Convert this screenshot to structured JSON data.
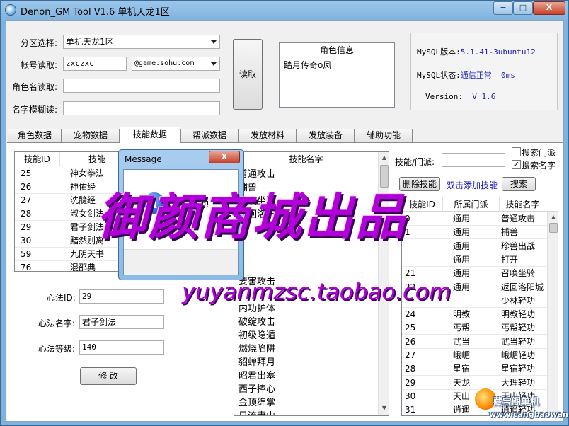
{
  "window": {
    "title": "Denon_GM Tool V1.6 单机天龙1区",
    "min_label": "−",
    "max_label": "□",
    "close_label": "X"
  },
  "top": {
    "zone_label": "分区选择:",
    "zone_value": "单机天龙1区",
    "account_label": "帐号读取:",
    "account_value": "zxczxc",
    "domain_value": "@game.sohu.com",
    "role_name_label": "角色名读取:",
    "fuzzy_label": "名字模糊读:",
    "read_button": "读取",
    "role_info_header": "角色信息",
    "role_info_items": [
      "踏月传奇o凤"
    ],
    "mysql_version_label": "MySQL版本:",
    "mysql_version_value": "5.1.41-3ubuntu12",
    "mysql_status_label": "MySQL状态:",
    "mysql_status_value": "通信正常",
    "mysql_status_ms": "0ms",
    "version_label": "Version:",
    "version_value": "V 1.6"
  },
  "tabs": [
    "角色数据",
    "宠物数据",
    "技能数据",
    "帮派数据",
    "发放材料",
    "发放装备",
    "辅助功能"
  ],
  "left_grid": {
    "headers": [
      "技能ID",
      "技能"
    ],
    "rows": [
      [
        "25",
        "神女拳法"
      ],
      [
        "26",
        "神佑经"
      ],
      [
        "27",
        "洗髓经"
      ],
      [
        "28",
        "淑女剑法"
      ],
      [
        "29",
        "君子剑法"
      ],
      [
        "30",
        "黯然别离"
      ],
      [
        "59",
        "九阴天书"
      ],
      [
        "76",
        "混邵典"
      ]
    ]
  },
  "xinfa": {
    "id_label": "心法ID:",
    "id_value": "29",
    "name_label": "心法名字:",
    "name_value": "君子剑法",
    "level_label": "心法等级:",
    "level_value": "140",
    "modify_button": "修  改"
  },
  "middle_list": {
    "header": "技能名字",
    "items": [
      "普通攻击",
      "捕兽",
      "召唤坐骑",
      "返回洛阳城",
      "",
      "",
      "",
      "",
      "要害攻击",
      "",
      "内功护体",
      "破绽攻击",
      "初级隐遁",
      "燃烧陷阱",
      "貂蝉拜月",
      "昭君出塞",
      "西子捧心",
      "金顶绵掌",
      "日流妻山"
    ]
  },
  "right": {
    "filter_label": "技能/门派:",
    "search_sect_label": "搜索门派",
    "search_sect_checked": false,
    "search_name_label": "搜索名字",
    "search_name_checked": true,
    "delete_button": "删除技能",
    "hint": "双击添加技能",
    "search_button": "搜索",
    "headers": [
      "技能ID",
      "所属门派",
      "技能名字"
    ],
    "rows": [
      [
        "0",
        "通用",
        "普通攻击"
      ],
      [
        "1",
        "通用",
        "捕兽"
      ],
      [
        "",
        "通用",
        "珍兽出战"
      ],
      [
        "",
        "通用",
        "打开"
      ],
      [
        "21",
        "通用",
        "召唤坐骑"
      ],
      [
        "22",
        "通用",
        "返回洛阳城"
      ],
      [
        "",
        "",
        "少林轻功"
      ],
      [
        "24",
        "明教",
        "明教轻功"
      ],
      [
        "25",
        "丐帮",
        "丐帮轻功"
      ],
      [
        "26",
        "武当",
        "武当轻功"
      ],
      [
        "27",
        "峨嵋",
        "峨嵋轻功"
      ],
      [
        "28",
        "星宿",
        "星宿轻功"
      ],
      [
        "29",
        "天龙",
        "大理轻功"
      ],
      [
        "30",
        "天山",
        "天山轻功"
      ],
      [
        "31",
        "逍遥",
        "逍遥轻功"
      ]
    ]
  },
  "dialog": {
    "title": "Message",
    "close_label": "X",
    "icon_glyph": "i",
    "message": "修改成功!"
  },
  "watermark": {
    "text": "御颜商城出品",
    "url": "yuyanmzsc.taobao.com"
  },
  "corner_badge": {
    "line1": "藏宝阁单机",
    "line2": "www.cangbaowan.net"
  }
}
